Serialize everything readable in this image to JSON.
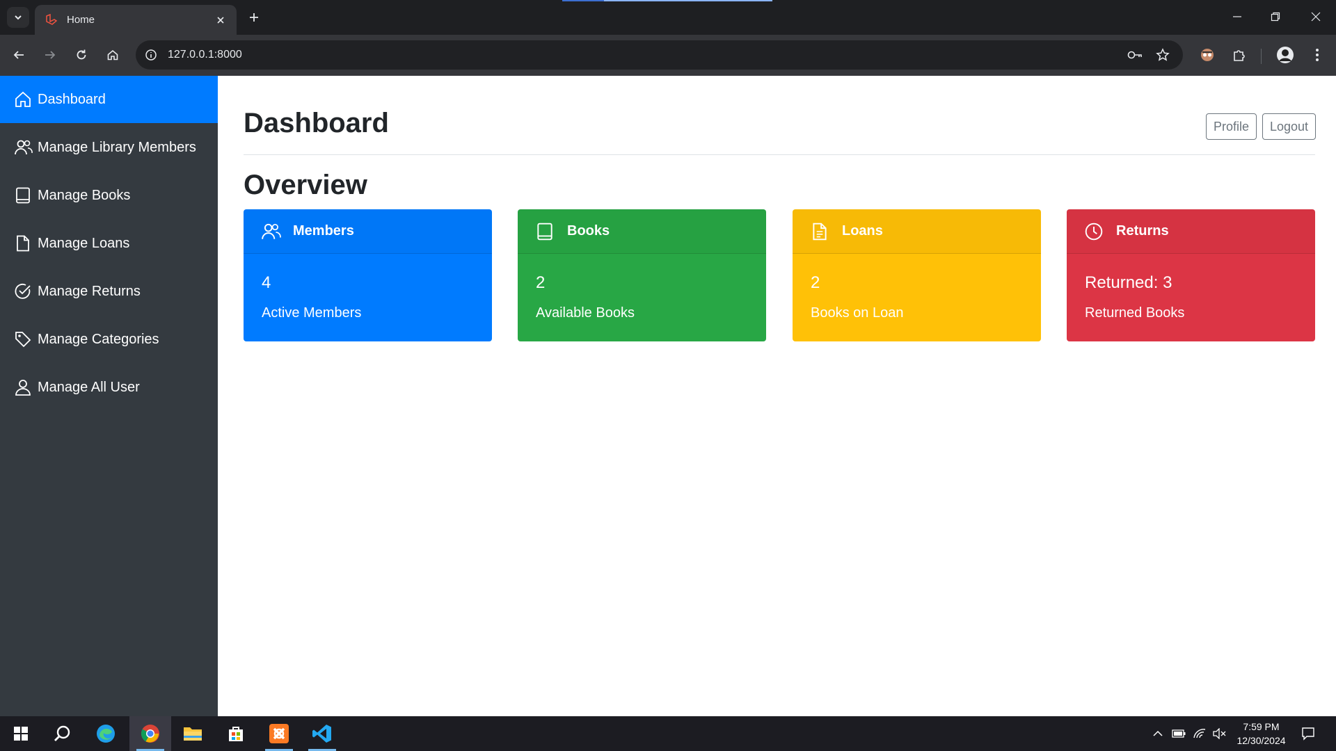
{
  "browser": {
    "tab_title": "Home",
    "url": "127.0.0.1:8000"
  },
  "sidebar": {
    "items": [
      {
        "label": "Dashboard",
        "icon": "house-icon",
        "active": true
      },
      {
        "label": "Manage Library Members",
        "icon": "people-icon",
        "active": false
      },
      {
        "label": "Manage Books",
        "icon": "book-icon",
        "active": false
      },
      {
        "label": "Manage Loans",
        "icon": "file-icon",
        "active": false
      },
      {
        "label": "Manage Returns",
        "icon": "check-circle-icon",
        "active": false
      },
      {
        "label": "Manage Categories",
        "icon": "tag-icon",
        "active": false
      },
      {
        "label": "Manage All User",
        "icon": "person-icon",
        "active": false
      }
    ]
  },
  "header": {
    "title": "Dashboard",
    "profile_label": "Profile",
    "logout_label": "Logout"
  },
  "overview": {
    "title": "Overview",
    "cards": [
      {
        "title": "Members",
        "value": "4",
        "label": "Active Members",
        "color": "#007bff",
        "icon": "people-icon"
      },
      {
        "title": "Books",
        "value": "2",
        "label": "Available Books",
        "color": "#28a745",
        "icon": "book-icon"
      },
      {
        "title": "Loans",
        "value": "2",
        "label": "Books on Loan",
        "color": "#ffc107",
        "icon": "file-text-icon"
      },
      {
        "title": "Returns",
        "value": "Returned: 3",
        "label": "Returned Books",
        "color": "#dc3545",
        "icon": "clock-icon"
      }
    ]
  },
  "taskbar": {
    "time": "7:59 PM",
    "date": "12/30/2024"
  }
}
